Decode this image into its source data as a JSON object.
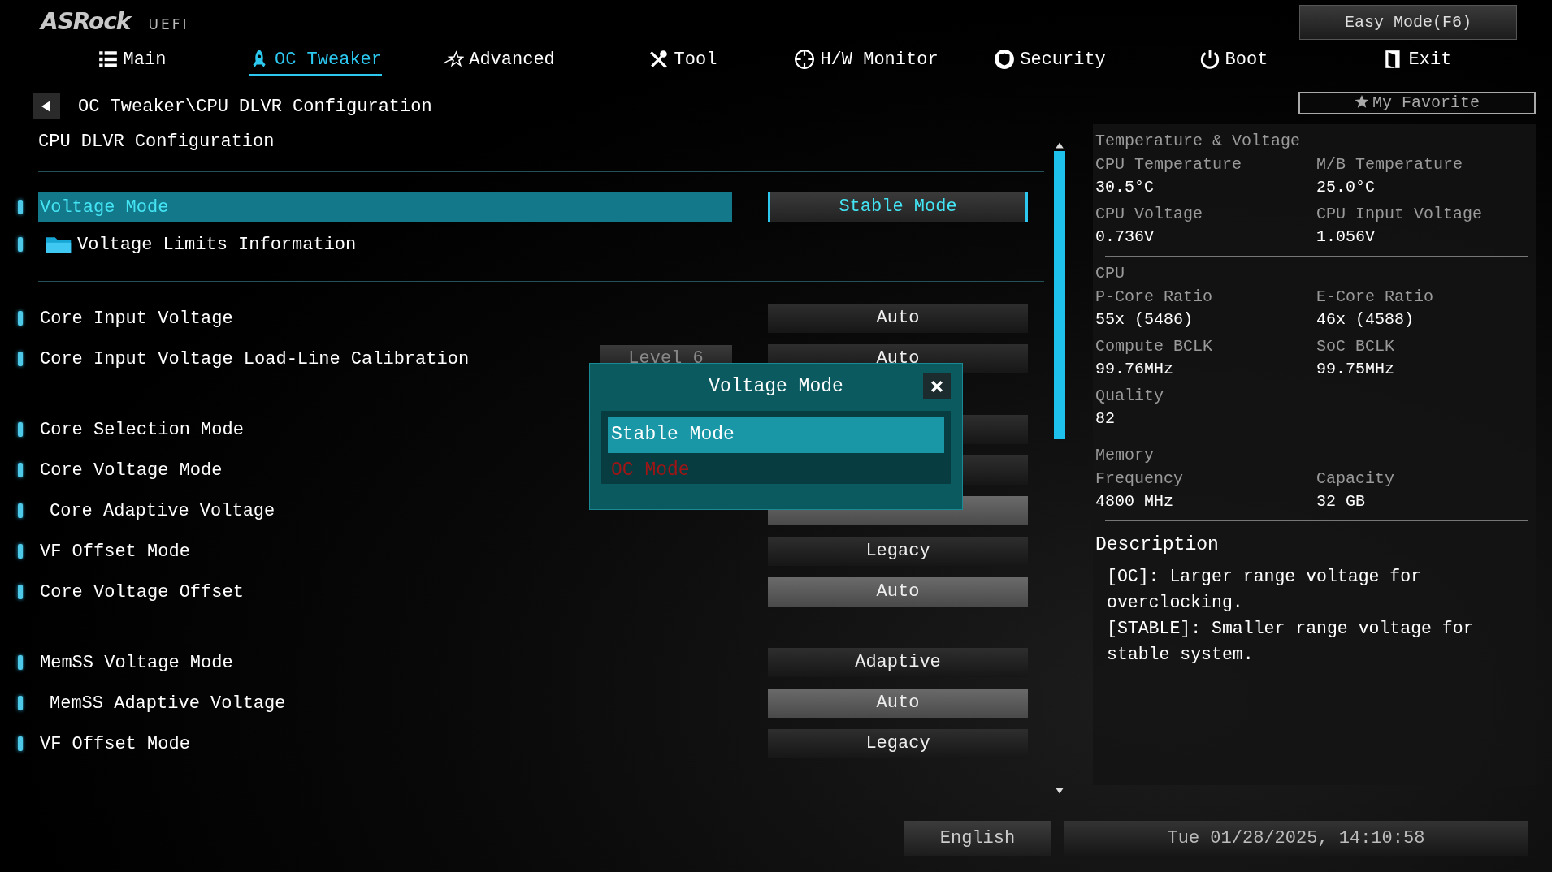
{
  "logo": {
    "brand": "ASRock",
    "suffix": "UEFI"
  },
  "easy_mode_button": "Easy Mode(F6)",
  "tabs": [
    {
      "label": "Main",
      "selected": false
    },
    {
      "label": "OC Tweaker",
      "selected": true
    },
    {
      "label": "Advanced",
      "selected": false
    },
    {
      "label": "Tool",
      "selected": false
    },
    {
      "label": "H/W Monitor",
      "selected": false
    },
    {
      "label": "Security",
      "selected": false
    },
    {
      "label": "Boot",
      "selected": false
    },
    {
      "label": "Exit",
      "selected": false
    }
  ],
  "favorite_button": "My Favorite",
  "breadcrumb": "OC Tweaker\\CPU DLVR Configuration",
  "page_title": "CPU DLVR Configuration",
  "groups": [
    {
      "divider": true,
      "rows": [
        {
          "kind": "dropdown",
          "label": "Voltage Mode",
          "value": "Stable Mode",
          "selected": true
        },
        {
          "kind": "submenu",
          "label": "Voltage Limits Information",
          "selected": false
        }
      ]
    },
    {
      "divider": false,
      "rows": [
        {
          "kind": "dropdown",
          "label": "Core Input Voltage",
          "value": "Auto",
          "selected": false
        },
        {
          "kind": "dropdown",
          "label": "Core Input Voltage Load-Line Calibration",
          "current": "Level 6",
          "value": "Auto",
          "selected": false
        }
      ]
    },
    {
      "divider": false,
      "rows": [
        {
          "kind": "dropdown",
          "label": "Core Selection Mode",
          "selected": false
        },
        {
          "kind": "dropdown",
          "label": "Core Voltage Mode",
          "selected": false,
          "children": [
            {
              "kind": "field",
              "label": "Core Adaptive Voltage",
              "selected": false
            }
          ]
        },
        {
          "kind": "dropdown",
          "label": "VF Offset Mode",
          "value": "Legacy",
          "selected": false
        },
        {
          "kind": "field",
          "label": "Core Voltage Offset",
          "value": "Auto",
          "selected": false
        }
      ]
    },
    {
      "divider": false,
      "rows": [
        {
          "kind": "dropdown",
          "label": "MemSS Voltage Mode",
          "value": "Adaptive",
          "selected": false,
          "children": [
            {
              "kind": "field",
              "label": "MemSS Adaptive Voltage",
              "value": "Auto",
              "selected": false
            }
          ]
        },
        {
          "kind": "dropdown",
          "label": "VF Offset Mode",
          "value": "Legacy",
          "selected": false
        }
      ]
    }
  ],
  "popup": {
    "title": "Voltage Mode",
    "options": [
      {
        "label": "Stable Mode",
        "selected": true
      },
      {
        "label": "OC Mode",
        "selected": false
      }
    ]
  },
  "info_panel": {
    "sections": [
      {
        "title": "Temperature & Voltage",
        "items": [
          {
            "label": "CPU Temperature",
            "value": "30.5°C"
          },
          {
            "label": "M/B Temperature",
            "value": "25.0°C"
          },
          {
            "label": "CPU Voltage",
            "value": "0.736V"
          },
          {
            "label": "CPU Input Voltage",
            "value": "1.056V"
          }
        ]
      },
      {
        "title": "CPU",
        "items": [
          {
            "label": "P-Core Ratio",
            "value": "55x (5486)"
          },
          {
            "label": "E-Core Ratio",
            "value": "46x (4588)"
          },
          {
            "label": "Compute BCLK",
            "value": "99.76MHz"
          },
          {
            "label": "SoC BCLK",
            "value": "99.75MHz"
          },
          {
            "label": "Quality",
            "value": "82"
          }
        ]
      },
      {
        "title": "Memory",
        "items": [
          {
            "label": "Frequency",
            "value": "4800 MHz"
          },
          {
            "label": "Capacity",
            "value": "32 GB"
          }
        ]
      }
    ],
    "description": {
      "title": "Description",
      "paragraphs": [
        "[OC]: Larger range voltage for overclocking.",
        "[STABLE]: Smaller range voltage for stable system."
      ]
    }
  },
  "footer": {
    "language": "English",
    "datetime": "Tue 01/28/2025, 14:10:58"
  }
}
